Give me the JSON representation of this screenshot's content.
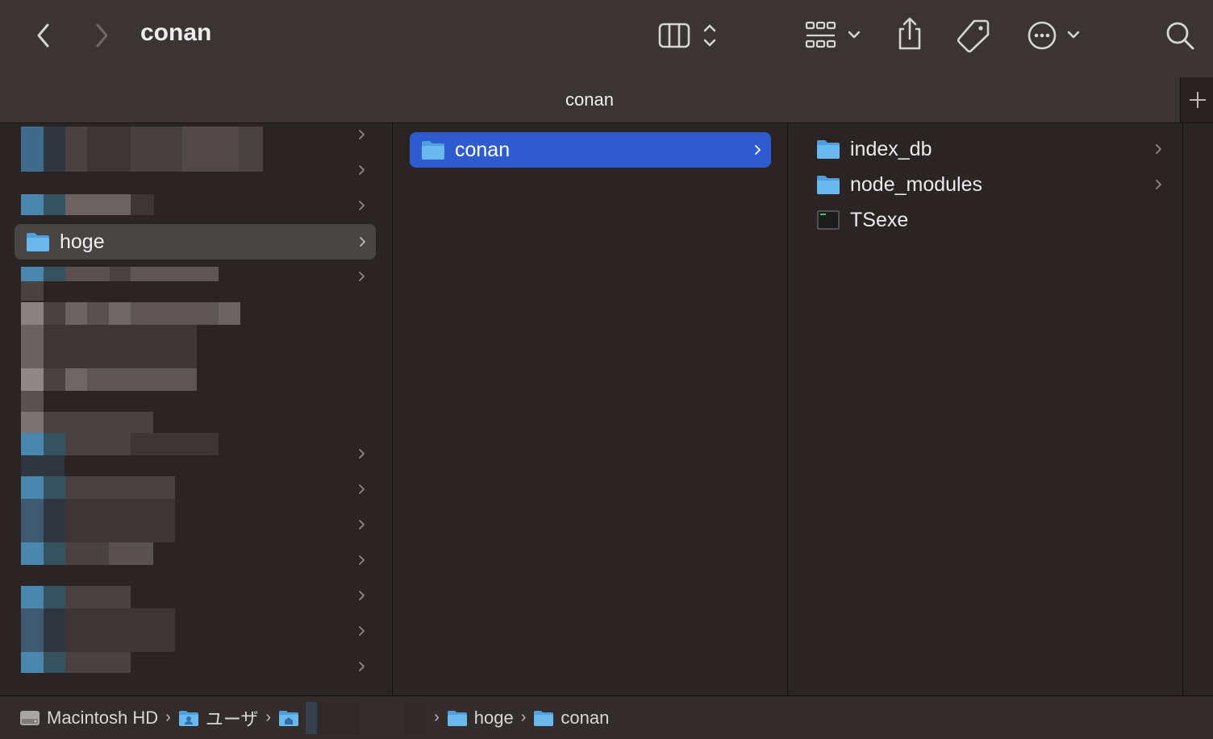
{
  "window": {
    "title": "conan"
  },
  "toolbar": {
    "back_icon": "chevron-left-icon",
    "forward_icon": "chevron-right-icon",
    "view_icon": "columns-view-icon",
    "group_icon": "grid-group-icon",
    "share_icon": "share-icon",
    "tag_icon": "tag-icon",
    "more_icon": "ellipsis-circle-icon",
    "search_icon": "search-icon"
  },
  "tab": {
    "label": "conan",
    "add_label": "+"
  },
  "column1": {
    "selected": {
      "label": "hoge"
    }
  },
  "column2": {
    "items": [
      {
        "label": "conan",
        "type": "folder",
        "selected": true
      }
    ]
  },
  "column3": {
    "items": [
      {
        "label": "index_db",
        "type": "folder"
      },
      {
        "label": "node_modules",
        "type": "folder"
      },
      {
        "label": "TSexe",
        "type": "executable"
      }
    ]
  },
  "path_bar": {
    "items": [
      {
        "label": "Macintosh HD",
        "icon": "disk-icon"
      },
      {
        "label": "ユーザ",
        "icon": "users-folder-icon"
      },
      {
        "label": "",
        "icon": "home-folder-icon"
      },
      {
        "label": "hoge",
        "icon": "folder-icon"
      },
      {
        "label": "conan",
        "icon": "folder-icon"
      }
    ]
  },
  "colors": {
    "accent": "#2e5ccf",
    "folder": "#5aaee8",
    "window_bg": "#2b2424",
    "toolbar_bg": "#3a3433"
  }
}
